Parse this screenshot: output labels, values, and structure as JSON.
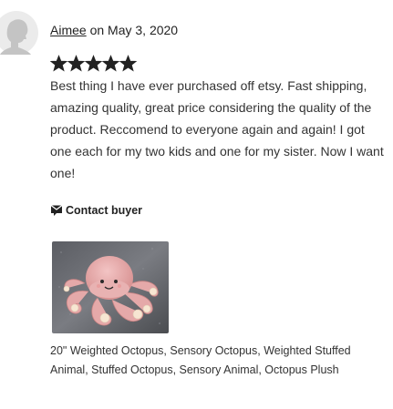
{
  "review": {
    "reviewer_name": "Aimee",
    "date_text": " on May 3, 2020",
    "rating": 5,
    "rating_max": 5,
    "text": "Best thing I have ever purchased off etsy. Fast shipping, amazing quality, great price considering the quality of the product. Reccomend to everyone again and again! I got one each for my two kids and one for my sister. Now I want one!",
    "contact_label": "Contact buyer",
    "contact_icon": "message-icon"
  },
  "product": {
    "title": "20\" Weighted Octopus, Sensory Octopus, Weighted Stuffed Animal, Stuffed Octopus, Sensory Animal, Octopus Plush",
    "image_icon": "octopus-plush-photo"
  },
  "colors": {
    "star": "#222222",
    "text": "#333333",
    "avatar_bg": "#ebebeb",
    "avatar_figure": "#c4c4c4"
  }
}
